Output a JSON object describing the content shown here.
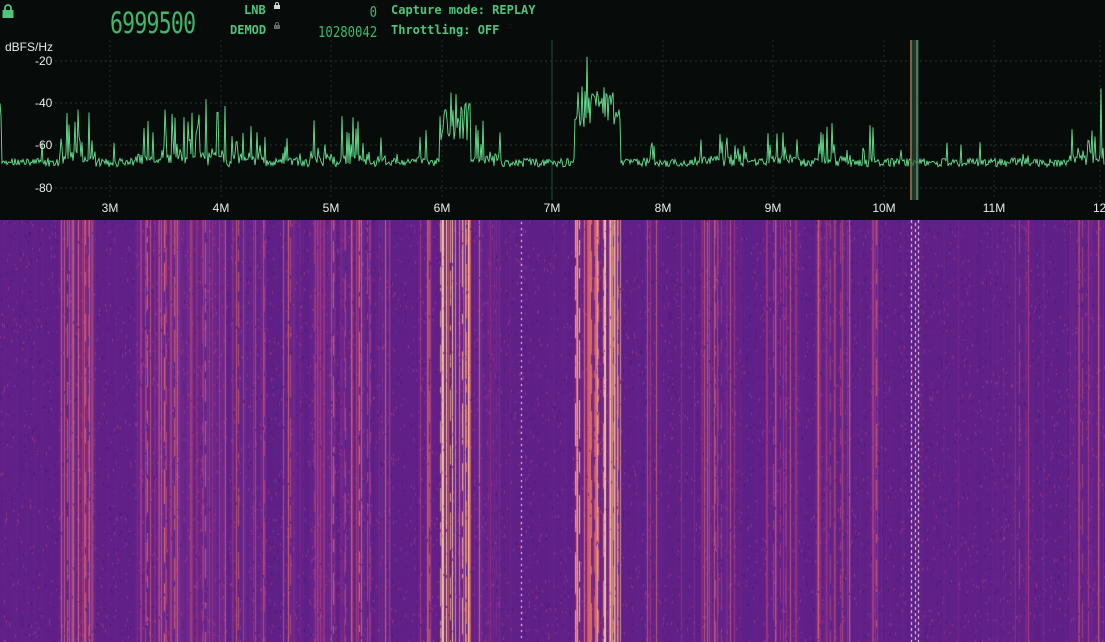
{
  "header": {
    "lock_icon": "lock-icon",
    "center_frequency": "6999500",
    "lnb_label": "LNB",
    "demod_label": "DEMOD",
    "lnb_value": "0",
    "demod_value": "10280042",
    "capture_mode": "Capture mode: REPLAY",
    "throttling": "Throttling: OFF",
    "accent_color": "#4fc47a"
  },
  "spectrum": {
    "unit_label": "dBFS/Hz",
    "y_ticks": [
      "-20",
      "-40",
      "-60",
      "-80"
    ],
    "x_ticks": [
      "3M",
      "4M",
      "5M",
      "6M",
      "7M",
      "8M",
      "9M",
      "10M",
      "11M",
      "12"
    ],
    "trace_color": "#67e090",
    "marker_color": "#e88a55"
  },
  "waterfall": {
    "palette": [
      "#5a1f86",
      "#7a2a8c",
      "#c2407a",
      "#ee7560",
      "#ffd49a"
    ]
  }
}
